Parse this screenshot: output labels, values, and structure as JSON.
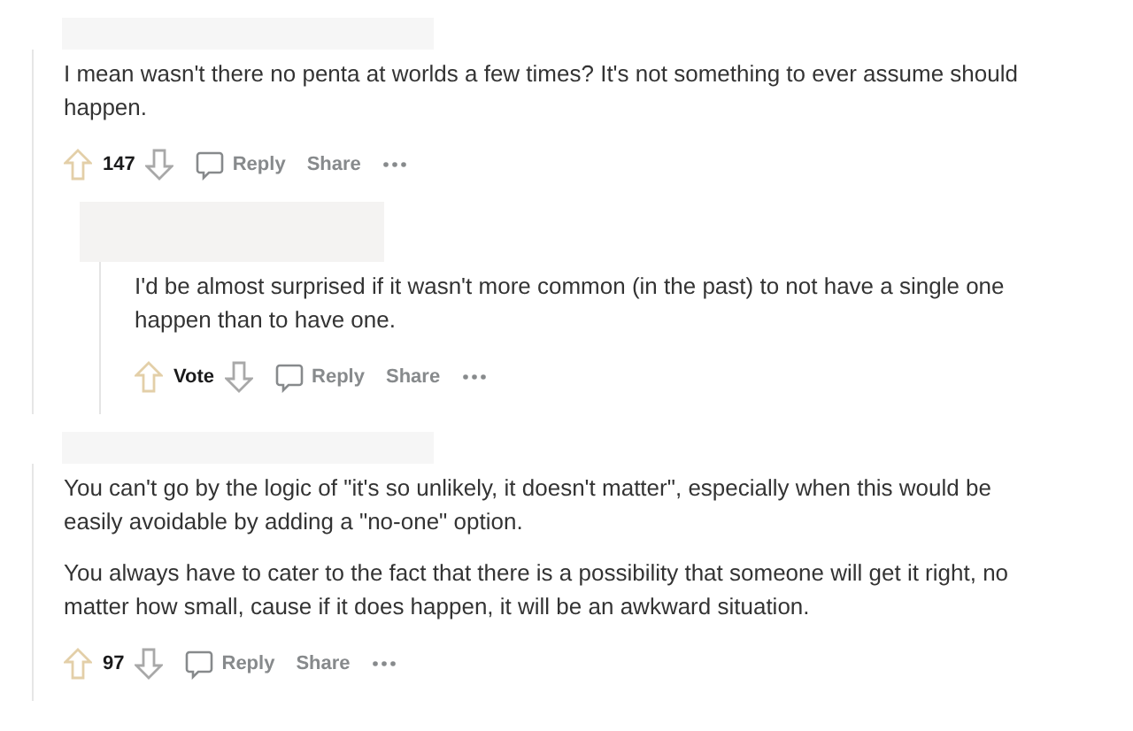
{
  "comments": [
    {
      "paragraphs": [
        "I mean wasn't there no penta at worlds a few times? It's not something to ever assume should happen."
      ],
      "votes": "147",
      "actions": [
        "Reply",
        "Share"
      ],
      "children": [
        {
          "paragraphs": [
            "I'd be almost surprised if it wasn't more common (in the past) to not have a single one happen than to have one."
          ],
          "votes": "Vote",
          "actions": [
            "Reply",
            "Share"
          ]
        }
      ]
    },
    {
      "paragraphs": [
        "You can't go by the logic of \"it's so unlikely, it doesn't matter\", especially when this would be easily avoidable by adding a \"no-one\" option.",
        "You always have to cater to the fact that there is a possibility that someone will get it right, no matter how small, cause if it does happen, it will be an awkward situation."
      ],
      "votes": "97",
      "actions": [
        "Reply",
        "Share"
      ]
    }
  ]
}
